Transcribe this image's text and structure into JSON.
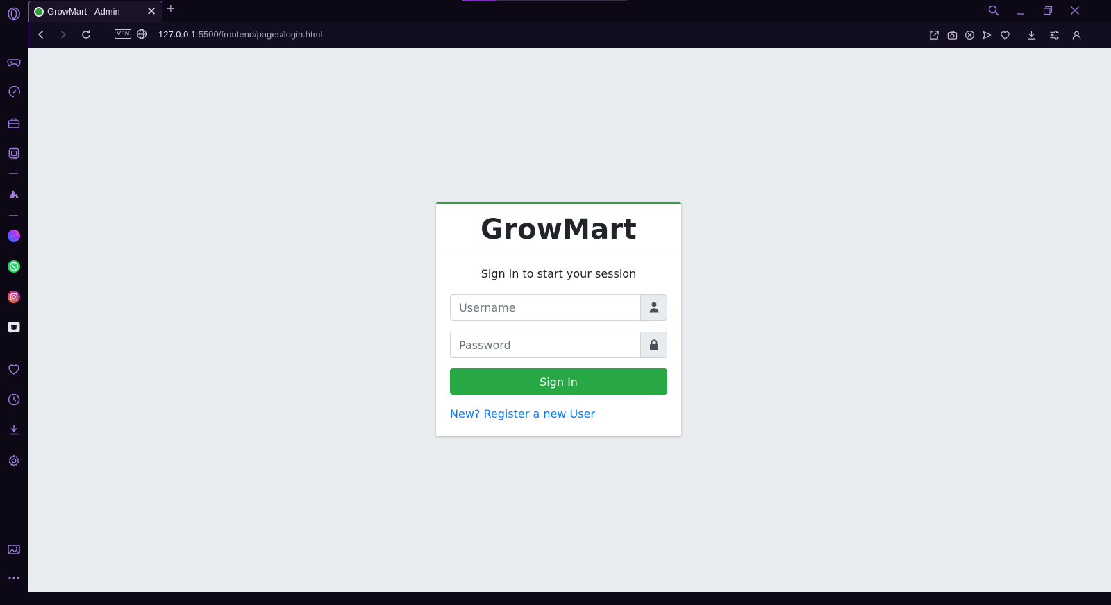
{
  "browser": {
    "tab": {
      "title": "GrowMart - Admin",
      "close_glyph": "✕"
    },
    "new_tab_glyph": "+",
    "address": {
      "url_host": "127.0.0.1",
      "url_rest": ":5500/frontend/pages/login.html",
      "vpn_label": "VPN"
    }
  },
  "sidebar": {
    "icons": [
      "opera-logo-icon",
      "gamepad-icon",
      "speed-dial-icon",
      "briefcase-icon",
      "extension-icon",
      "aria-icon",
      "messenger-icon",
      "whatsapp-icon",
      "instagram-icon",
      "discord-icon",
      "heart-icon",
      "history-icon",
      "download-icon",
      "settings-icon",
      "gallery-icon",
      "more-icon"
    ]
  },
  "login": {
    "brand": "GrowMart",
    "message": "Sign in to start your session",
    "username_placeholder": "Username",
    "password_placeholder": "Password",
    "signin_label": "Sign In",
    "register_label": "New? Register a new User"
  },
  "colors": {
    "accent": "#28a745",
    "link": "#007bff",
    "browser_accent": "#7b4fd0",
    "page_bg": "#e9ecef"
  }
}
